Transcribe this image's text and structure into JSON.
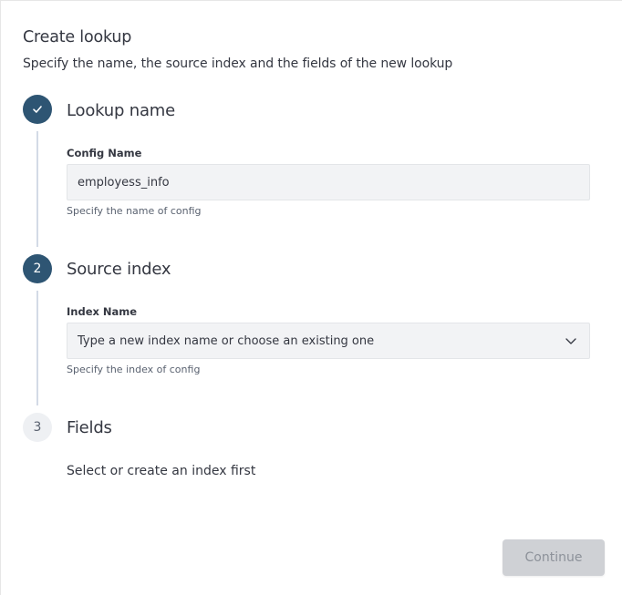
{
  "header": {
    "title": "Create lookup",
    "subtitle": "Specify the name, the source index and the fields of the new lookup"
  },
  "steps": [
    {
      "number": "1",
      "status": "complete",
      "icon": "check-icon",
      "title": "Lookup name",
      "field_label": "Config Name",
      "field_value": "employess_info",
      "help_text": "Specify the name of config"
    },
    {
      "number": "2",
      "status": "active",
      "title": "Source index",
      "field_label": "Index Name",
      "field_placeholder": "Type a new index name or choose an existing one",
      "help_text": "Specify the index of config",
      "icon": "chevron-down-icon"
    },
    {
      "number": "3",
      "status": "pending",
      "title": "Fields",
      "empty_text": "Select or create an index first"
    }
  ],
  "footer": {
    "continue_label": "Continue",
    "continue_disabled": true
  },
  "colors": {
    "step_active": "#2e5573",
    "step_pending": "#eef0f3",
    "field_bg": "#f2f3f5",
    "button_disabled_bg": "#cfd1d5",
    "button_disabled_text": "#8d929a"
  }
}
